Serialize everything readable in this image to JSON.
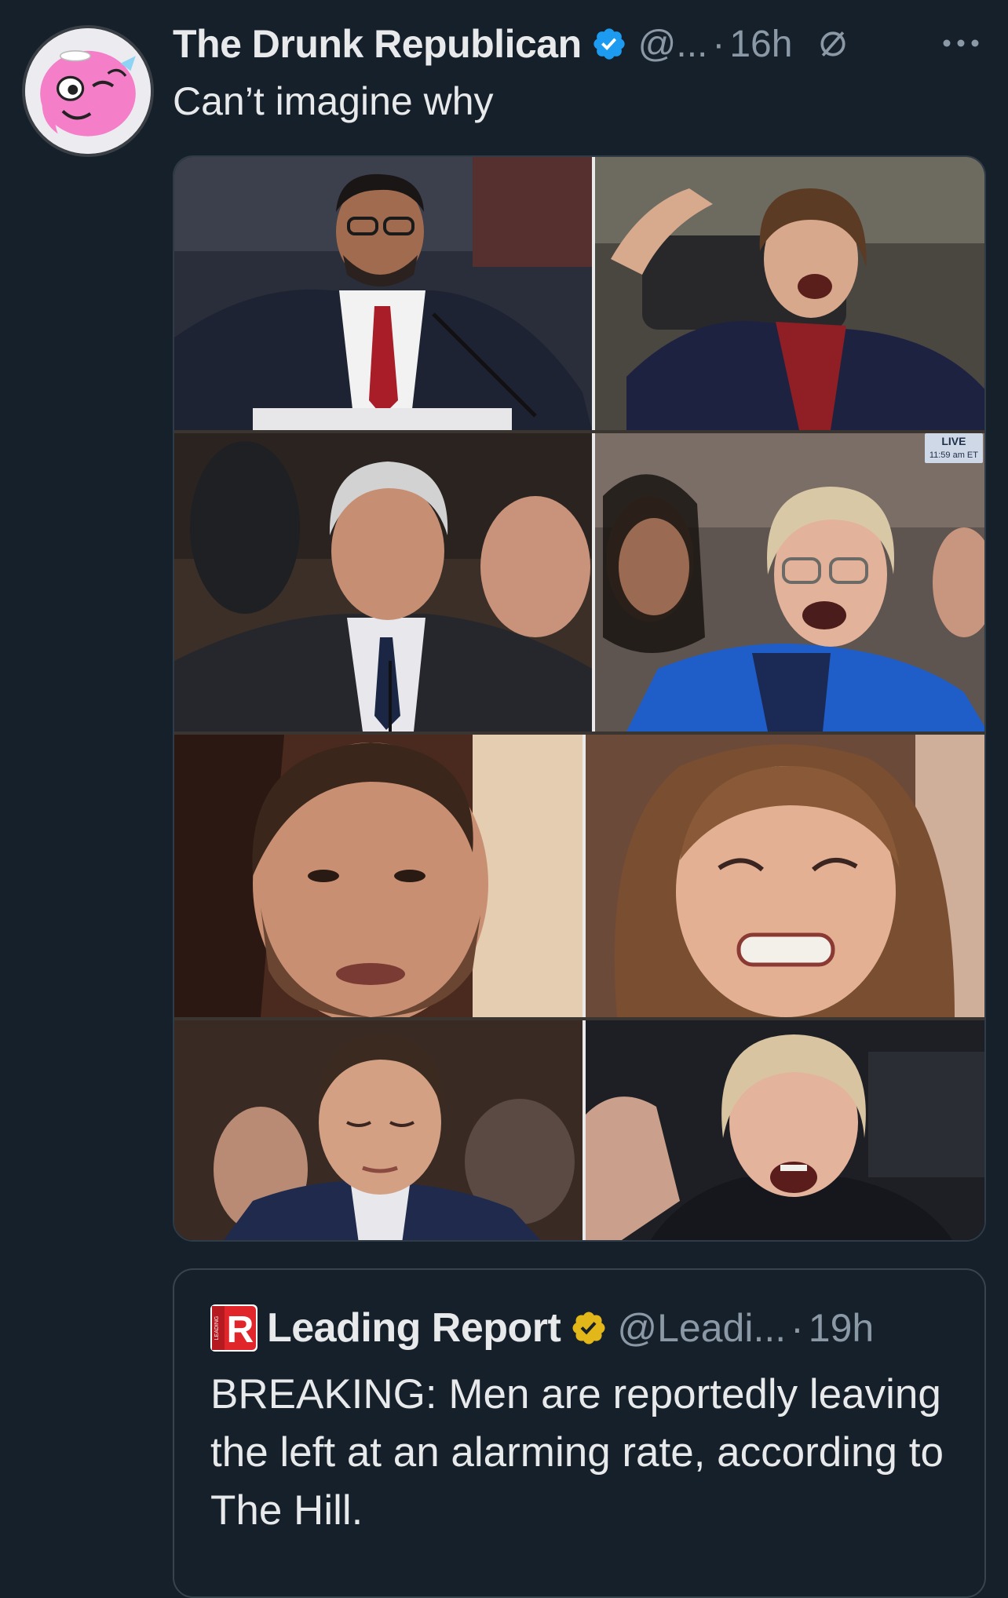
{
  "tweet": {
    "display_name": "The Drunk Republican",
    "handle": "@...",
    "separator": "·",
    "time": "16h",
    "text": "Can’t imagine why",
    "verified_color": "#1d9bf0",
    "icons": [
      "verified-badge-icon",
      "mute-icon",
      "more-options-icon"
    ]
  },
  "media": {
    "photo_count": 8,
    "live_badge": {
      "label": "LIVE",
      "time": "11:59 am ET"
    }
  },
  "quote": {
    "logo_letter": "R",
    "logo_side_text": "LEADING",
    "display_name": "Leading Report",
    "handle": "@Leadi...",
    "separator": "·",
    "time": "19h",
    "text": "BREAKING: Men are reportedly leaving the left at an alarming rate, according to The Hill.",
    "verified_color": "#e2b719",
    "logo_color": "#e0262b"
  },
  "colors": {
    "background": "#15202b",
    "primary_text": "#e7e9ea",
    "secondary_text": "#8b98a5",
    "border": "#38444d"
  }
}
